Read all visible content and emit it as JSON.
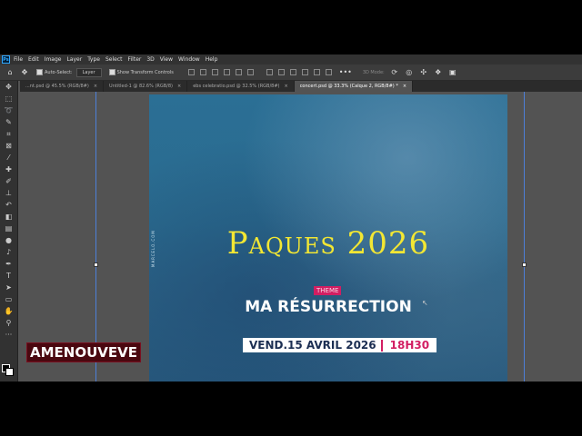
{
  "menubar": {
    "logo": "Ps",
    "items": [
      "File",
      "Edit",
      "Image",
      "Layer",
      "Type",
      "Select",
      "Filter",
      "3D",
      "View",
      "Window",
      "Help"
    ]
  },
  "options": {
    "auto_select_label": "Auto-Select:",
    "auto_select_value": "Layer",
    "transform_label": "Show Transform Controls",
    "mode_3d_label": "3D Mode:"
  },
  "tabs": [
    {
      "label": "...nt.psd @ 45.5% (RGB/8#)"
    },
    {
      "label": "Untitled-1 @ 82.6% (RGB/8)"
    },
    {
      "label": "ebs celebratio.psd @ 32.5% (RGB/8#)"
    },
    {
      "label": "concert.psd @ 33.3% (Calque 2, RGB/8#) *"
    }
  ],
  "poster": {
    "side_credit": "MARCELO.COM",
    "title": "Paques 2026",
    "theme_badge": "THEME",
    "subtitle": "MA RÉSURRECTION",
    "date": "VEND.15 AVRIL 2026",
    "time": "18H30"
  },
  "overlay_label": "AMENOUVEVE",
  "colors": {
    "accent_pink": "#d21e62",
    "title_yellow": "#f3e733",
    "guide_blue": "#4d7fd8"
  }
}
